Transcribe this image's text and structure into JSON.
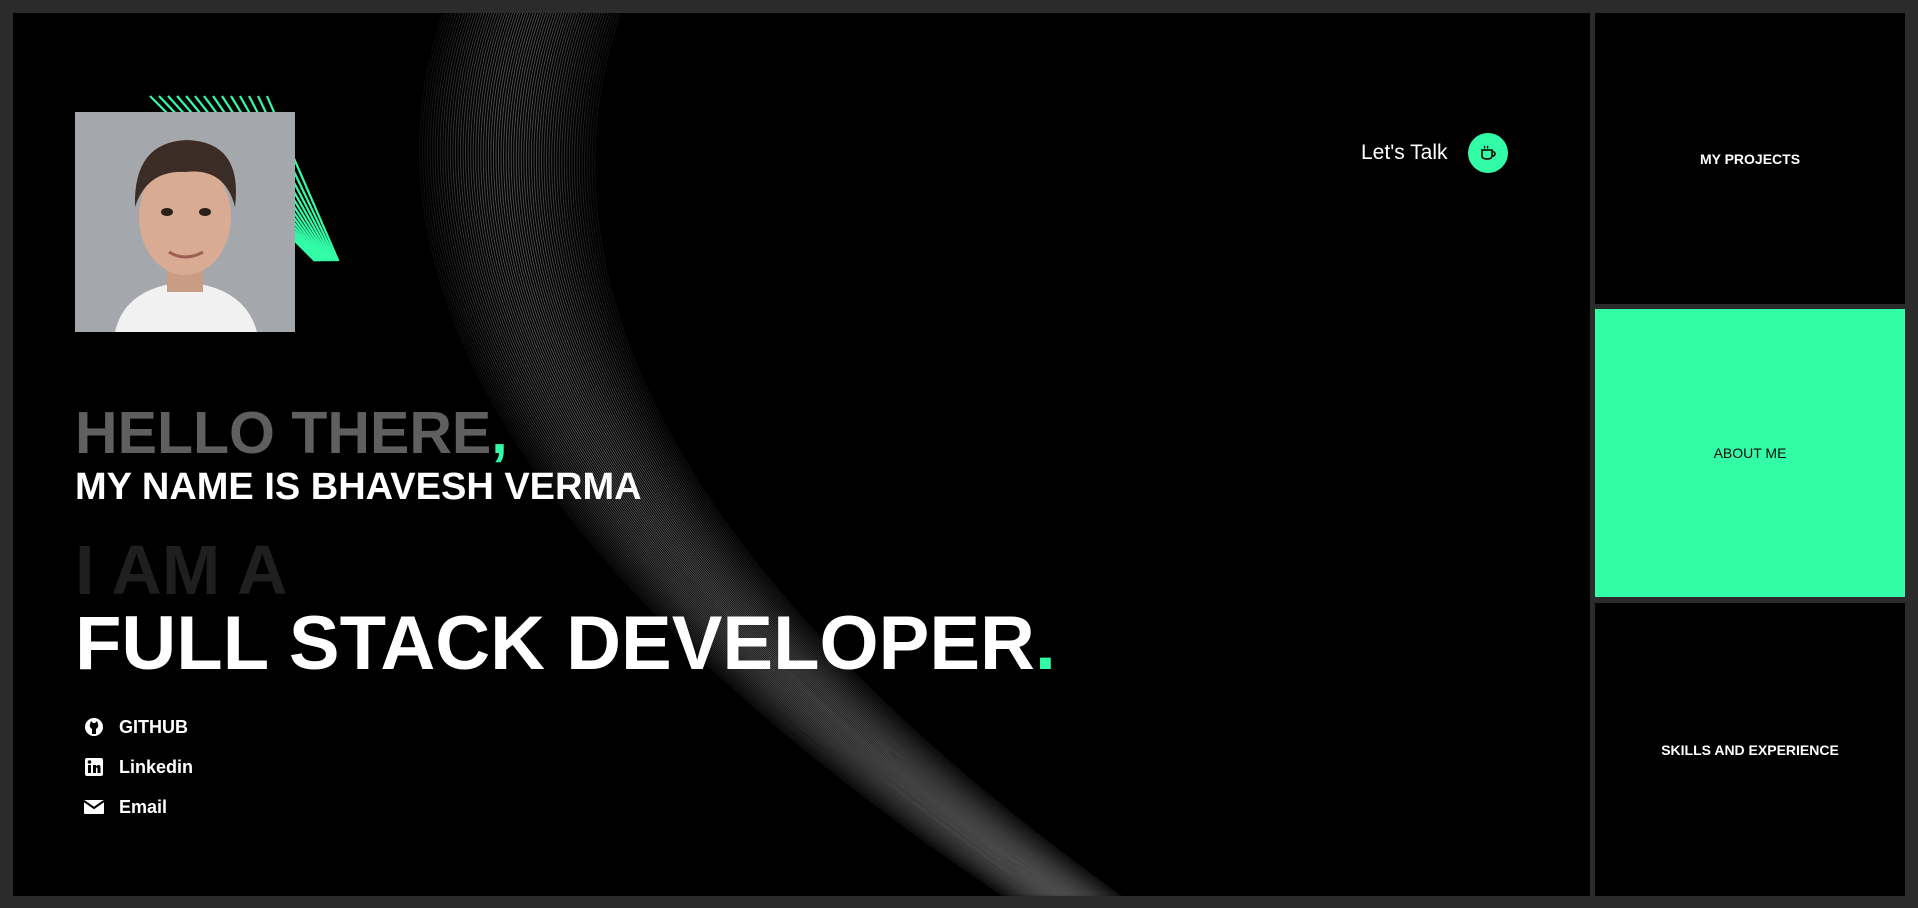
{
  "colors": {
    "accent": "#33fca6",
    "background": "#000000",
    "frame": "#2b2b2b"
  },
  "profile": {
    "avatar_alt": "profile-photo"
  },
  "header": {
    "talk_label": "Let's Talk",
    "talk_icon": "coffee-cup-icon"
  },
  "hero": {
    "greeting": "HELLO THERE",
    "greeting_punct": ",",
    "name_line": "MY NAME IS BHAVESH VERMA",
    "prefix": "I AM A",
    "role": "FULL STACK DEVELOPER",
    "role_punct": "."
  },
  "social": [
    {
      "label": "GITHUB",
      "icon": "github-icon"
    },
    {
      "label": "Linkedin",
      "icon": "linkedin-icon"
    },
    {
      "label": "Email",
      "icon": "email-icon"
    }
  ],
  "sidebar": {
    "items": [
      {
        "label": "MY PROJECTS"
      },
      {
        "label": "ABOUT ME",
        "active": true
      },
      {
        "label": "SKILLS AND EXPERIENCE"
      }
    ]
  }
}
